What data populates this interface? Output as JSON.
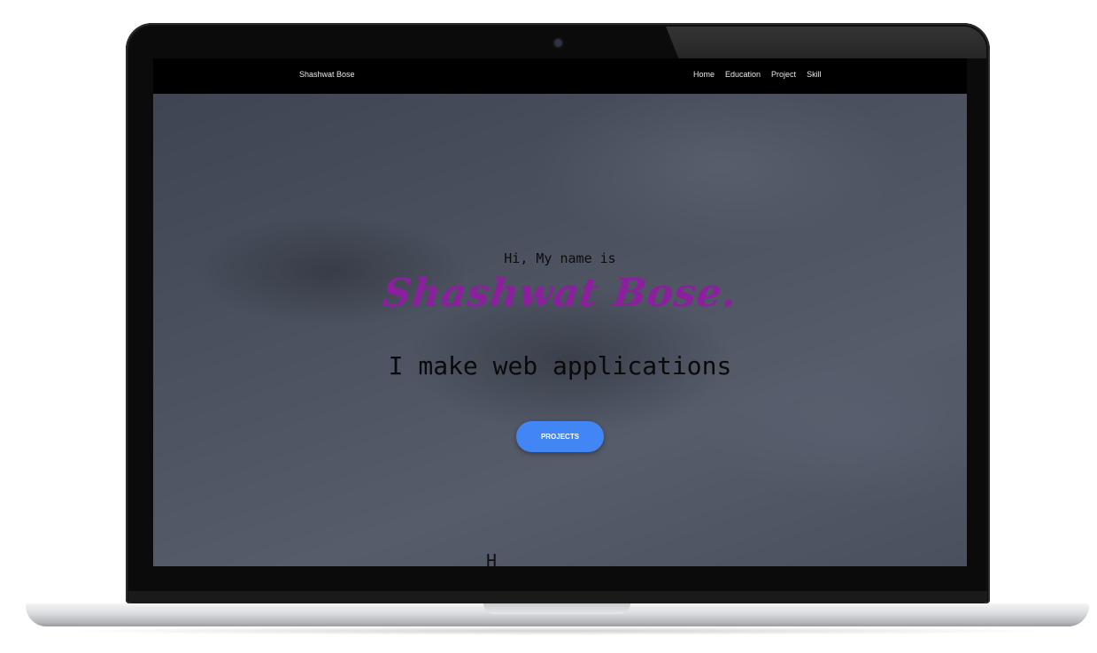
{
  "navbar": {
    "brand": "Shashwat Bose",
    "links": [
      "Home",
      "Education",
      "Project",
      "Skill"
    ]
  },
  "hero": {
    "greeting": "Hi, My name is",
    "name": "Shashwat Bose.",
    "tagline": "I make web applications",
    "button_label": "PROJECTS",
    "scroll_glyph": "H"
  },
  "colors": {
    "navbar_bg": "#000000",
    "name_accent": "#8c1f9e",
    "button_bg": "#4285f4"
  }
}
